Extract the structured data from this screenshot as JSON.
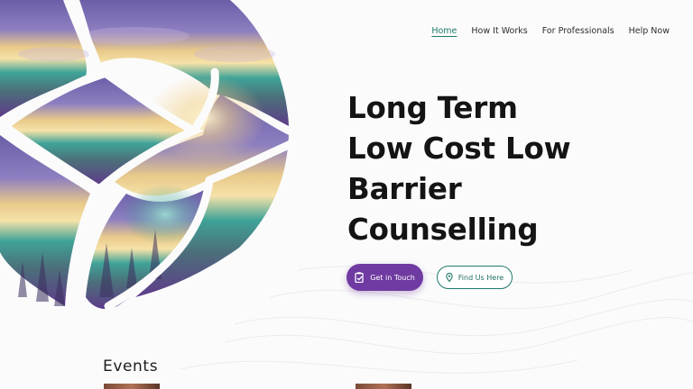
{
  "nav": {
    "items": [
      {
        "label": "Home",
        "active": true
      },
      {
        "label": "How It Works",
        "active": false
      },
      {
        "label": "For Professionals",
        "active": false
      },
      {
        "label": "Help Now",
        "active": false
      }
    ]
  },
  "hero": {
    "headline_lines": [
      "Long Term",
      "Low Cost Low",
      "Barrier",
      "Counselling"
    ],
    "primary_button": {
      "label": "Get in Touch",
      "icon": "clipboard-check-icon"
    },
    "secondary_button": {
      "label": "Find Us Here",
      "icon": "map-pin-icon"
    }
  },
  "events": {
    "title": "Events"
  },
  "colors": {
    "accent_purple": "#6f3aa1",
    "accent_teal": "#1e7a6d"
  }
}
